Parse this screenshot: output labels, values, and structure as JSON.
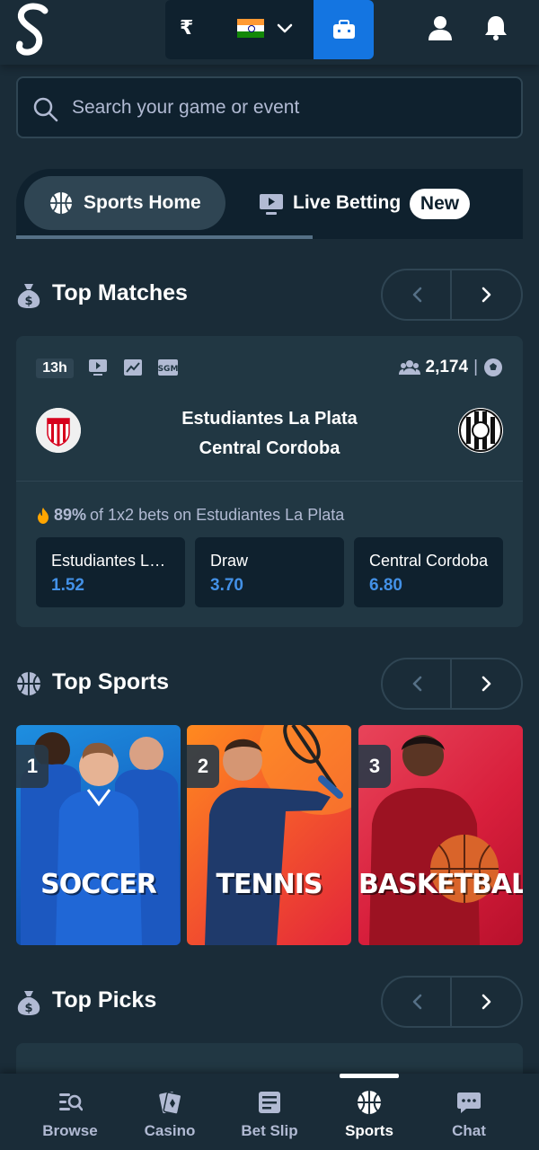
{
  "header": {
    "currency_symbol": "₹",
    "country": "India",
    "icons": [
      "stake-logo",
      "flag-india-icon",
      "chevron-down-icon",
      "wallet-icon",
      "user-icon",
      "bell-icon"
    ]
  },
  "search": {
    "placeholder": "Search your game or event"
  },
  "tabs": [
    {
      "label": "Sports Home",
      "active": true
    },
    {
      "label": "Live Betting",
      "badge": "New",
      "active": false
    }
  ],
  "sections": {
    "top_matches": "Top Matches",
    "top_sports": "Top Sports",
    "top_picks": "Top Picks"
  },
  "match": {
    "time": "13h",
    "bettors": "2,174",
    "sep": "|",
    "home": "Estudiantes La Plata",
    "away": "Central Cordoba",
    "stat_pct": "89%",
    "stat_text": "of 1x2 bets on Estudiantes La Plata",
    "odds": [
      {
        "name": "Estudiantes La Plata",
        "price": "1.52"
      },
      {
        "name": "Draw",
        "price": "3.70"
      },
      {
        "name": "Central Cordoba",
        "price": "6.80"
      }
    ]
  },
  "sports": [
    {
      "rank": "1",
      "name": "SOCCER"
    },
    {
      "rank": "2",
      "name": "TENNIS"
    },
    {
      "rank": "3",
      "name": "BASKETBALL"
    }
  ],
  "bottom_nav": [
    {
      "label": "Browse",
      "active": false
    },
    {
      "label": "Casino",
      "active": false
    },
    {
      "label": "Bet Slip",
      "active": false
    },
    {
      "label": "Sports",
      "active": true
    },
    {
      "label": "Chat",
      "active": false
    }
  ],
  "colors": {
    "background": "#1a2c38",
    "panel": "#213743",
    "dark": "#0f212e",
    "accent_blue": "#1475e1",
    "odds_blue": "#4391e7",
    "muted_text": "#b1bad3"
  }
}
